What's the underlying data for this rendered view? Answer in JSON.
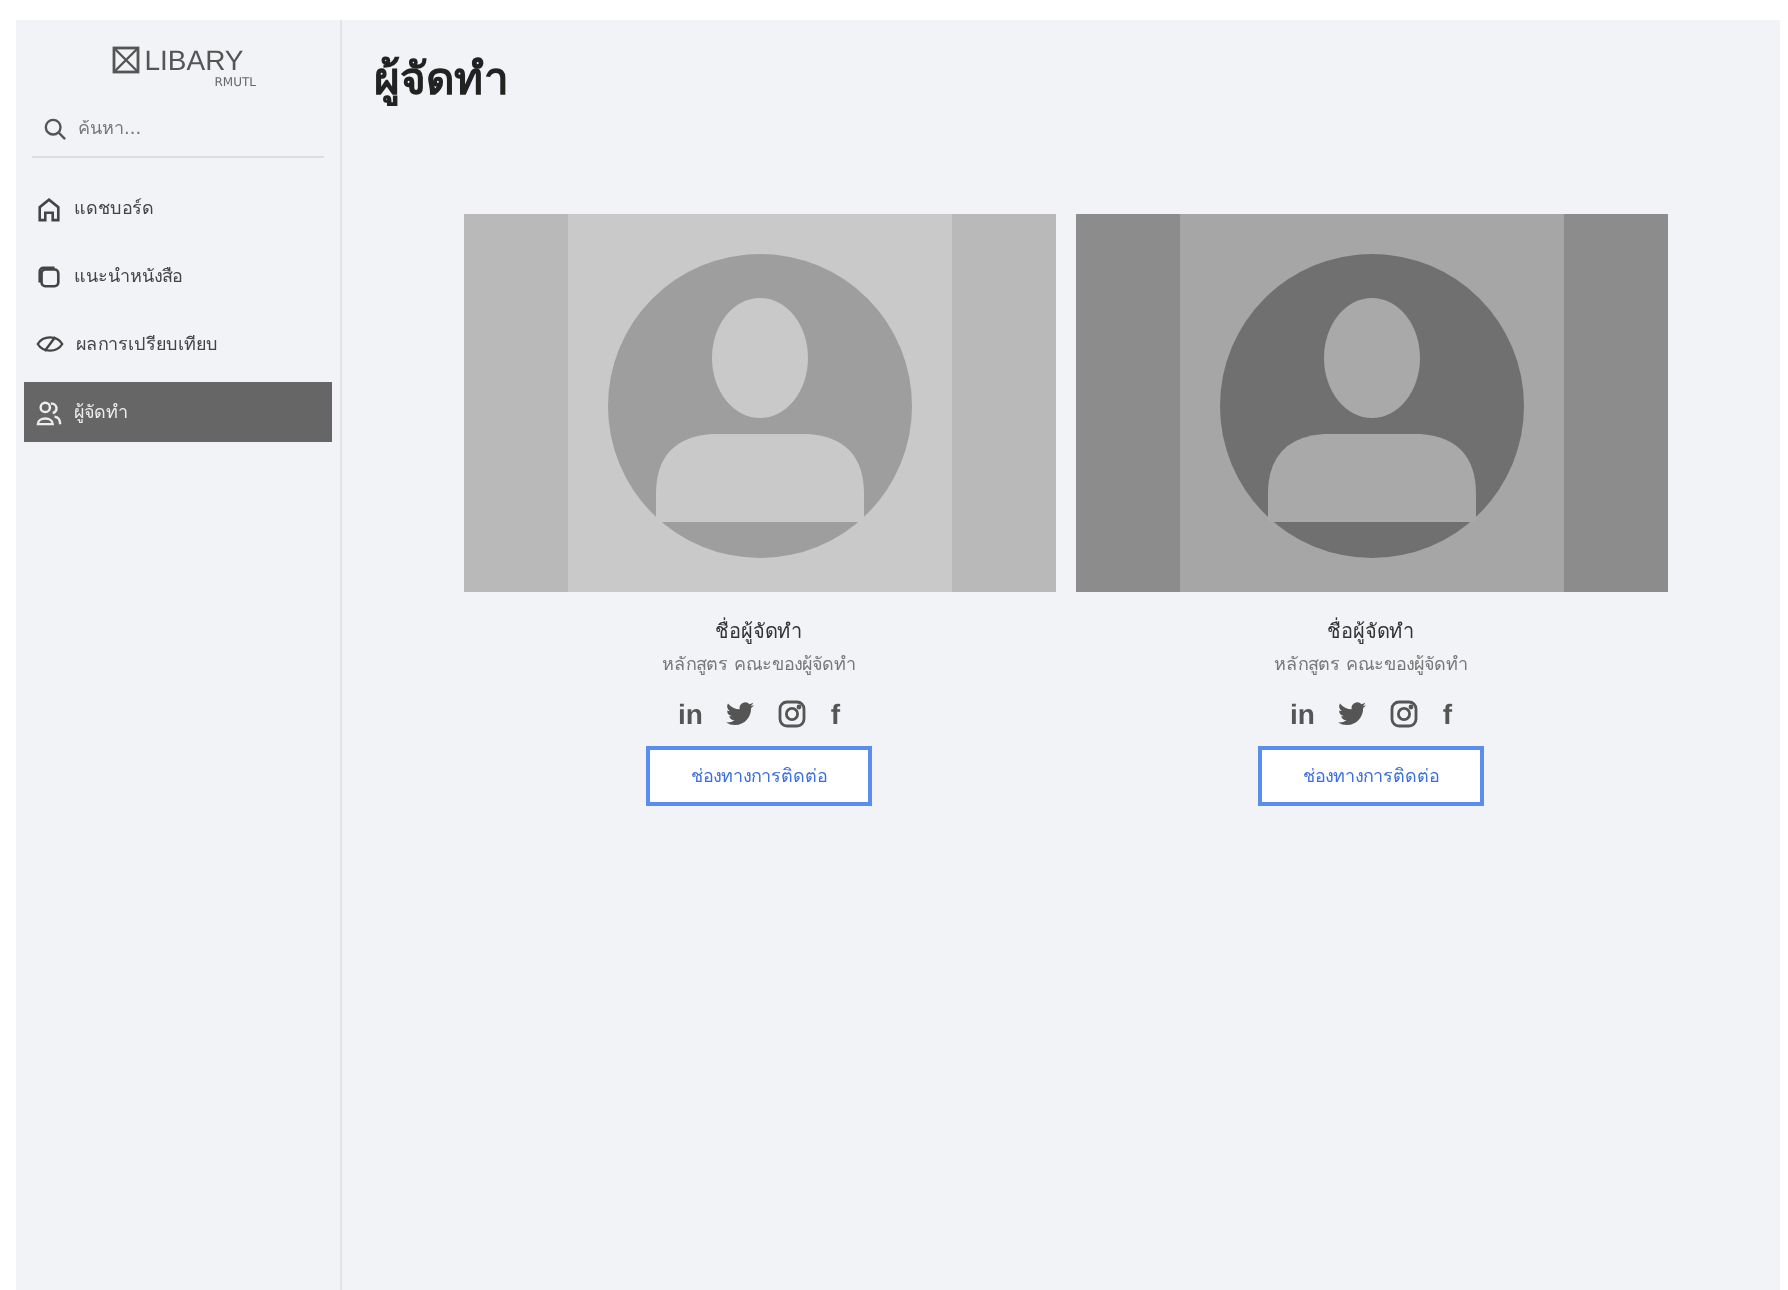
{
  "logo": {
    "title": "LIBARY",
    "subtitle": "RMUTL"
  },
  "search": {
    "placeholder": "ค้นหา..."
  },
  "sidebar": {
    "items": [
      {
        "label": "แดชบอร์ด",
        "kind": "home",
        "selected": false
      },
      {
        "label": "แนะนำหนังสือ",
        "kind": "book",
        "selected": false
      },
      {
        "label": "ผลการเปรียบเทียบ",
        "kind": "compare",
        "selected": false
      },
      {
        "label": "ผู้จัดทำ",
        "kind": "people",
        "selected": true
      }
    ]
  },
  "page_title": "ผู้จัดทำ",
  "members": [
    {
      "name": "ชื่อผู้จัดทำ",
      "program": "หลักสูตร คณะของผู้จัดทำ",
      "socials": [
        {
          "kind": "text",
          "text": "in"
        },
        {
          "kind": "bird"
        },
        {
          "kind": "camera"
        },
        {
          "kind": "text",
          "text": "f"
        }
      ],
      "button": "ช่องทางการติดต่อ"
    },
    {
      "name": "ชื่อผู้จัดทำ",
      "program": "หลักสูตร คณะของผู้จัดทำ",
      "socials": [
        {
          "kind": "text",
          "text": "in"
        },
        {
          "kind": "bird"
        },
        {
          "kind": "camera"
        },
        {
          "kind": "text",
          "text": "f"
        }
      ],
      "button": "ช่องทางการติดต่อ"
    }
  ]
}
